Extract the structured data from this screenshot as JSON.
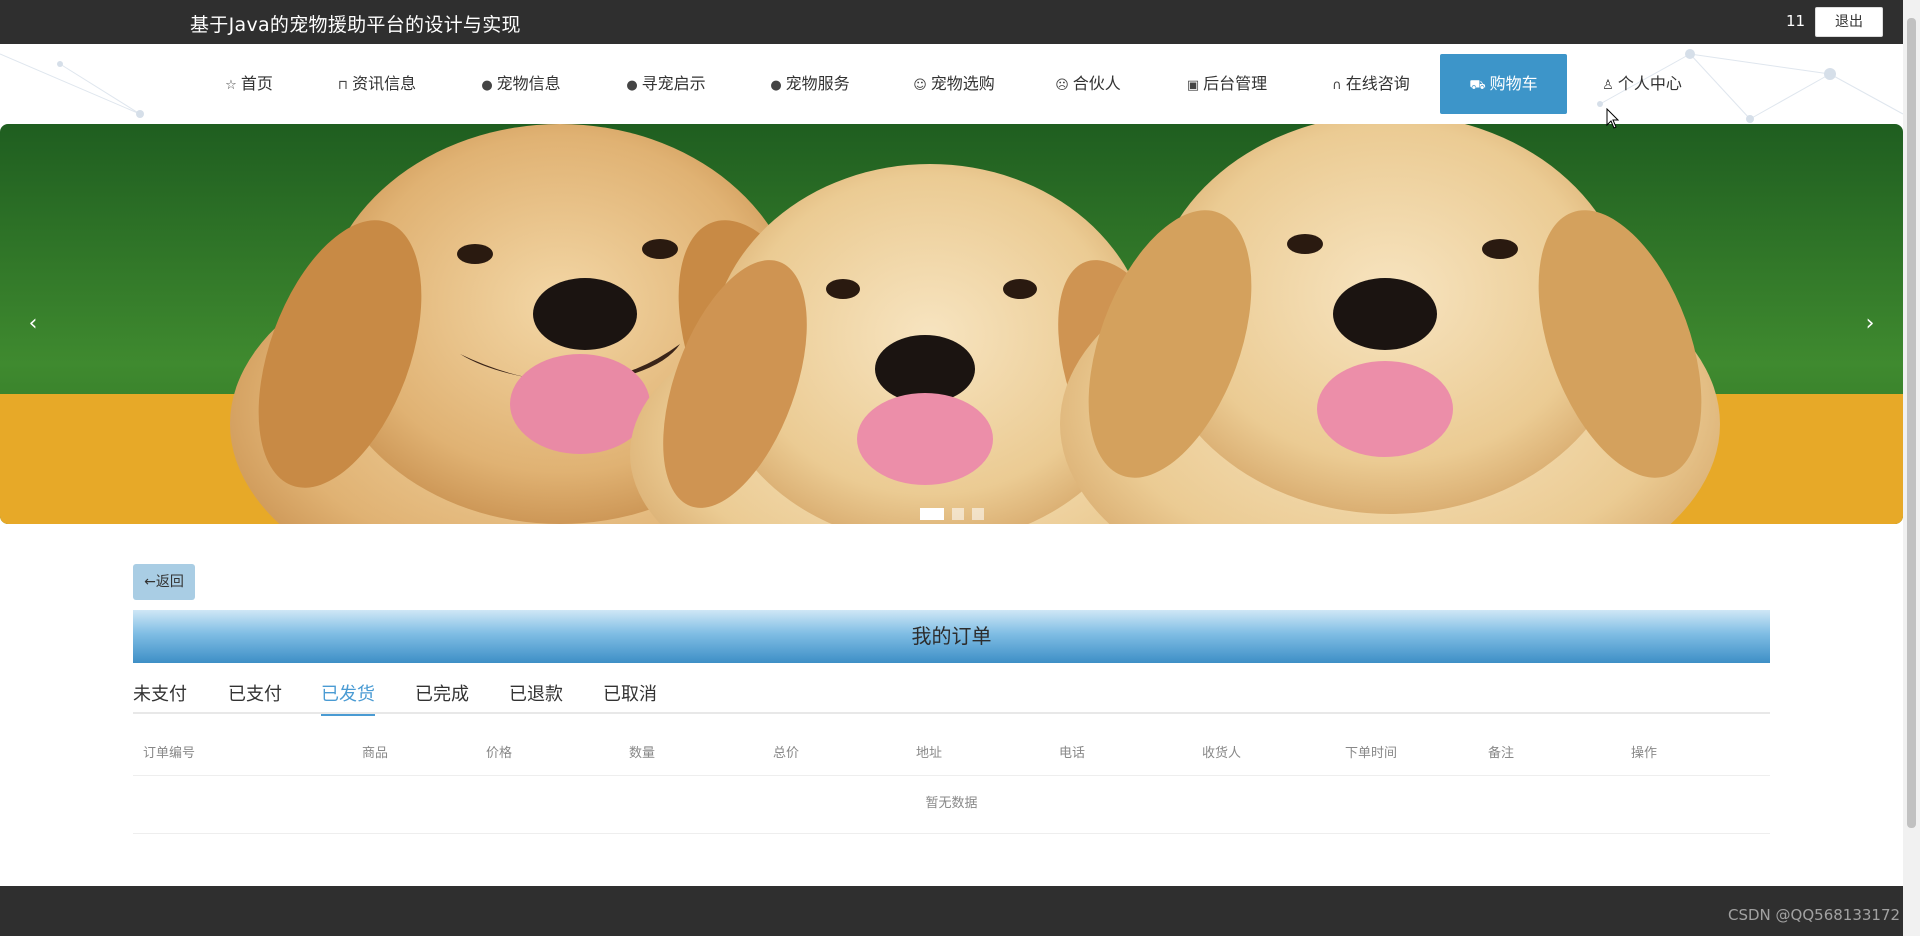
{
  "header": {
    "title": "基于Java的宠物援助平台的设计与实现",
    "user_count": "11",
    "logout_label": "退出"
  },
  "nav": {
    "items": [
      {
        "label": "首页",
        "icon": "star-icon"
      },
      {
        "label": "资讯信息",
        "icon": "bag-icon"
      },
      {
        "label": "宠物信息",
        "icon": "alert-icon"
      },
      {
        "label": "寻宠启示",
        "icon": "question-icon"
      },
      {
        "label": "宠物服务",
        "icon": "info-icon"
      },
      {
        "label": "宠物选购",
        "icon": "smile-icon"
      },
      {
        "label": "合伙人",
        "icon": "face-icon"
      },
      {
        "label": "后台管理",
        "icon": "box-icon"
      },
      {
        "label": "在线咨询",
        "icon": "headset-icon"
      },
      {
        "label": "购物车",
        "icon": "cart-icon",
        "active": true
      },
      {
        "label": "个人中心",
        "icon": "user-icon"
      }
    ]
  },
  "banner": {
    "prev": "‹",
    "next": "›",
    "slides": 3,
    "active_slide": 1
  },
  "orders": {
    "back_label": "←返回",
    "title": "我的订单",
    "tabs": [
      "未支付",
      "已支付",
      "已发货",
      "已完成",
      "已退款",
      "已取消"
    ],
    "active_tab": "已发货",
    "columns": [
      "订单编号",
      "商品",
      "价格",
      "数量",
      "总价",
      "地址",
      "电话",
      "收货人",
      "下单时间",
      "备注",
      "操作"
    ],
    "empty_text": "暂无数据"
  },
  "footer": {
    "watermark": "CSDN @QQ568133172"
  },
  "colors": {
    "topbar": "#2f2f2f",
    "accent": "#3d95c9",
    "tab_active": "#4a9bd3"
  }
}
